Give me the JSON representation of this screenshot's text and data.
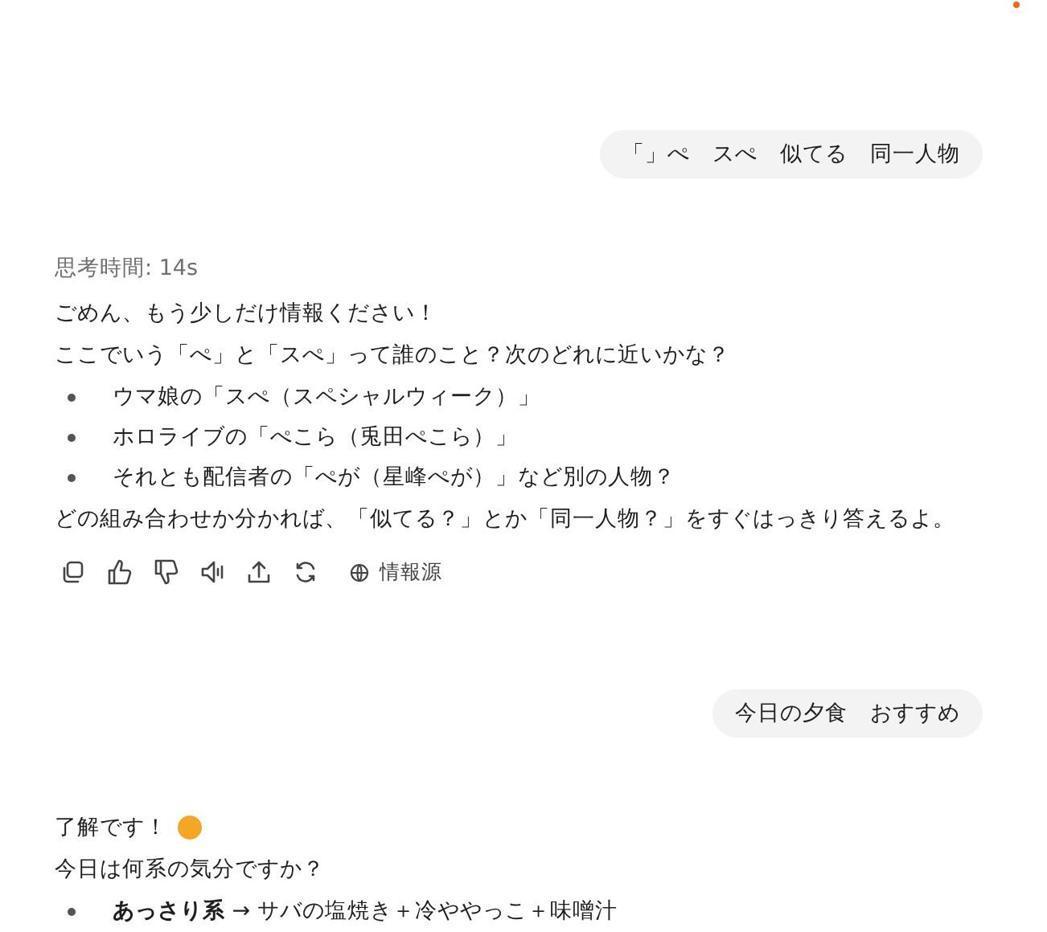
{
  "messages": [
    {
      "kind": "user",
      "text": "「」ぺ　スぺ　似てる　同一人物"
    },
    {
      "kind": "assistant",
      "thinking": "思考時間: 14s",
      "blocks": [
        {
          "kind": "para",
          "text": "ごめん、もう少しだけ情報ください！"
        },
        {
          "kind": "para",
          "text": "ここでいう「ぺ」と「スぺ」って誰のこと？次のどれに近いかな？"
        },
        {
          "kind": "list",
          "items": [
            "ウマ娘の「スぺ（スペシャルウィーク）」",
            "ホロライブの「ぺこら（兎田ぺこら）」",
            "それとも配信者の「ぺが（星峰ぺが）」など別の人物？"
          ]
        },
        {
          "kind": "para",
          "text": "どの組み合わせか分かれば、「似てる？」とか「同一人物？」をすぐはっきり答えるよ。"
        }
      ],
      "actions": [
        {
          "kind": "copy"
        },
        {
          "kind": "like"
        },
        {
          "kind": "dislike"
        },
        {
          "kind": "speaker"
        },
        {
          "kind": "share"
        },
        {
          "kind": "regenerate"
        },
        {
          "kind": "sources",
          "label": "情報源"
        }
      ]
    },
    {
      "kind": "user",
      "text": "今日の夕食　おすすめ"
    },
    {
      "kind": "assistant",
      "blocks": [
        {
          "kind": "para",
          "text": "了解です！",
          "emoji": true
        },
        {
          "kind": "para",
          "text": "今日は何系の気分ですか？"
        },
        {
          "kind": "list",
          "items": [
            "**あっさり系** → サバの塩焼き＋冷ややっこ＋味噌汁"
          ]
        }
      ]
    }
  ]
}
